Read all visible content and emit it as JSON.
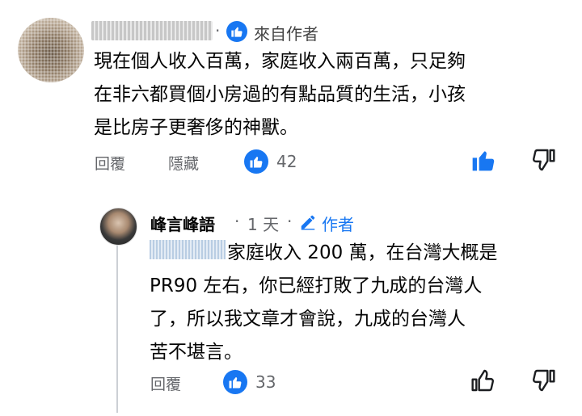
{
  "comment": {
    "meta_dot": "·",
    "source_label": "來自作者",
    "text_lines": [
      "現在個人收入百萬，家庭收入兩百萬，只足夠",
      "在非六都買個小房過的有點品質的生活，小孩",
      "是比房子更奢侈的神獸。"
    ],
    "reply_label": "回覆",
    "hide_label": "隱藏",
    "like_count": "42"
  },
  "reply": {
    "author_name": "峰言峰語",
    "meta_dot": "·",
    "time": "1 天",
    "meta_dot2": "·",
    "author_tag": "作者",
    "text_lines": [
      "家庭收入 200 萬，在台灣大概是",
      "PR90 左右，你已經打敗了九成的台灣人",
      "了，所以我文章才會說，九成的台灣人",
      "苦不堪言。"
    ],
    "reply_label": "回覆",
    "like_count": "33"
  },
  "colors": {
    "accent": "#1877f2",
    "text": "#050505",
    "muted": "#65676b"
  },
  "icons": [
    "like-badge-icon",
    "thumbs-up-icon",
    "thumbs-down-icon",
    "pencil-icon"
  ]
}
